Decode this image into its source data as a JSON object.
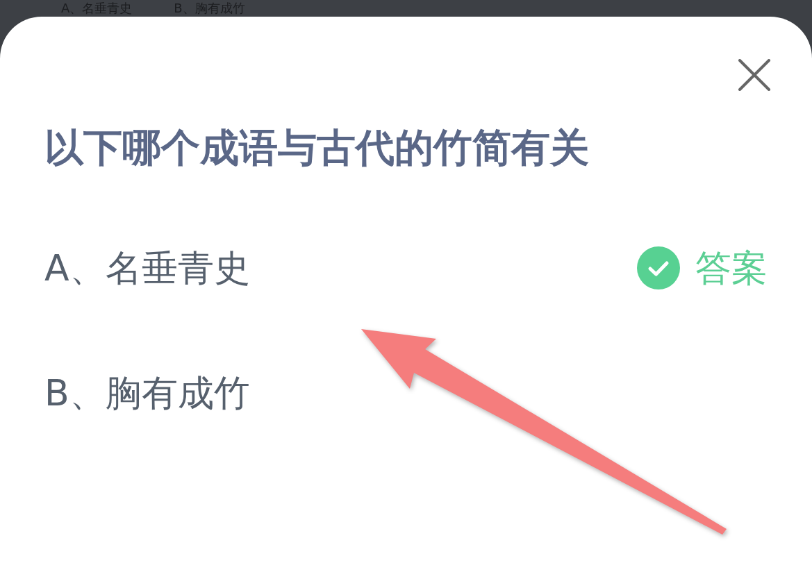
{
  "background_options": [
    "A、名垂青史",
    "B、胸有成竹"
  ],
  "dialog": {
    "question": "以下哪个成语与古代的竹简有关",
    "options": [
      {
        "label": "A、名垂青史",
        "answer": true
      },
      {
        "label": "B、胸有成竹",
        "answer": false
      }
    ],
    "answer_label": "答案"
  }
}
